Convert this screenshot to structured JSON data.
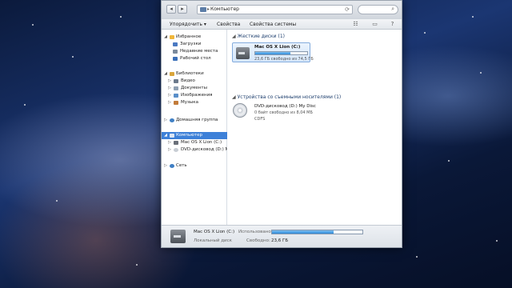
{
  "window": {
    "address": {
      "location": "Компьютер",
      "separator": "▸"
    },
    "toolbar": {
      "organize": "Упорядочить ▾",
      "properties": "Свойства",
      "system_properties": "Свойства системы"
    }
  },
  "nav": {
    "favorites": {
      "label": "Избранное",
      "items": [
        "Загрузки",
        "Недавние места",
        "Рабочий стол"
      ]
    },
    "libraries": {
      "label": "Библиотеки",
      "items": [
        "Видео",
        "Документы",
        "Изображения",
        "Музыка"
      ]
    },
    "homegroup": "Домашняя группа",
    "computer": {
      "label": "Компьютер",
      "items": [
        "Mac OS X Lion (C:)",
        "DVD-дисковод (D:) M"
      ]
    },
    "network": "Сеть"
  },
  "main": {
    "hard_drives_header": "Жесткие диски (1)",
    "drive": {
      "name": "Mac OS X Lion (C:)",
      "free_text": "23,6 ГБ свободно из 74,5 ГБ",
      "used_fraction": 0.68
    },
    "removable_header": "Устройства со съемными носителями (1)",
    "dvd": {
      "name": "DVD-дисковод (D:) My Disc",
      "free_text": "0 байт свободно из 8,04 МБ",
      "filesystem": "CDFS"
    }
  },
  "details": {
    "name": "Mac OS X Lion (C:)",
    "type": "Локальный диск",
    "used_label": "Использовано:",
    "free_label": "Свободно:",
    "free_value": "23,6 ГБ",
    "used_fraction": 0.68
  }
}
